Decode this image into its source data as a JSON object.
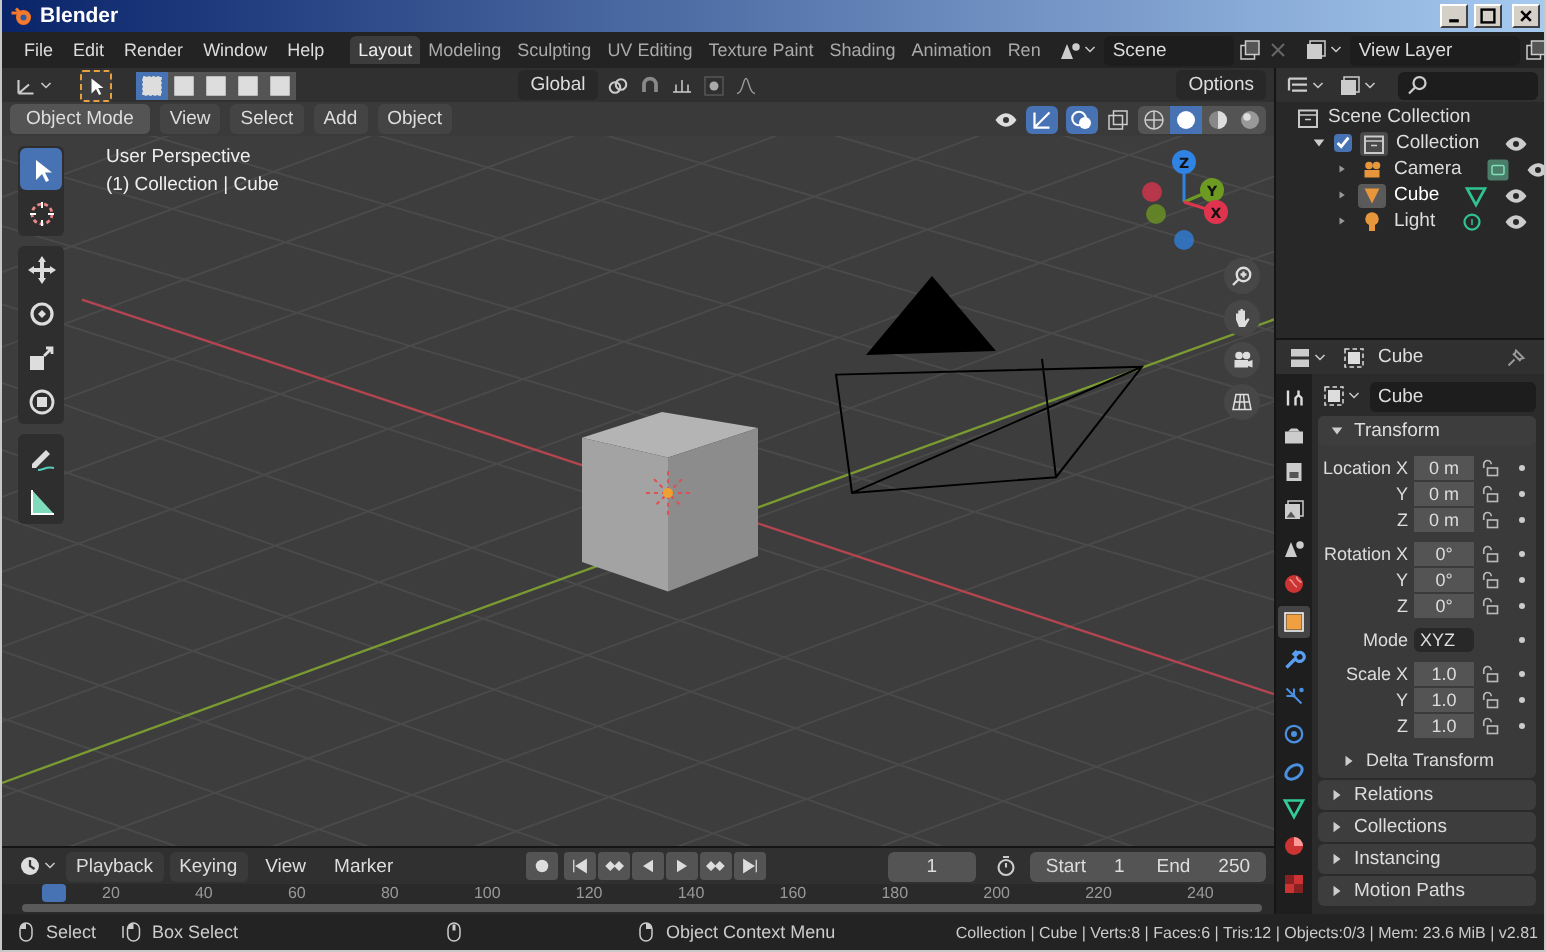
{
  "window": {
    "title": "Blender"
  },
  "menu": [
    "File",
    "Edit",
    "Render",
    "Window",
    "Help"
  ],
  "workspaces": [
    {
      "label": "Layout",
      "selected": true
    },
    {
      "label": "Modeling",
      "selected": false
    },
    {
      "label": "Sculpting",
      "selected": false
    },
    {
      "label": "UV Editing",
      "selected": false
    },
    {
      "label": "Texture Paint",
      "selected": false
    },
    {
      "label": "Shading",
      "selected": false
    },
    {
      "label": "Animation",
      "selected": false
    },
    {
      "label": "Ren",
      "selected": false
    }
  ],
  "scene": {
    "value": "Scene"
  },
  "view_layer": {
    "value": "View Layer"
  },
  "viewport": {
    "select_tool_on": true,
    "select_modes": [
      {
        "selected": true
      },
      {
        "selected": false
      },
      {
        "selected": false
      },
      {
        "selected": false
      },
      {
        "selected": false
      }
    ],
    "orientation": "Global",
    "options": "Options",
    "mode": "Object Mode",
    "menus": [
      "View",
      "Select",
      "Add",
      "Object"
    ],
    "gizmos_on": true,
    "overlays_on": true,
    "shading_modes": [
      {
        "kind": "wireframe",
        "selected": false
      },
      {
        "kind": "solid",
        "selected": true
      },
      {
        "kind": "material",
        "selected": false
      },
      {
        "kind": "rendered",
        "selected": false
      }
    ],
    "overlay_text": [
      "User Perspective",
      "(1) Collection | Cube"
    ],
    "tool_groups": [
      [
        {
          "kind": "select",
          "selected": true
        },
        {
          "kind": "cursor",
          "selected": false
        }
      ],
      [
        {
          "kind": "move",
          "selected": false
        },
        {
          "kind": "rotate",
          "selected": false
        },
        {
          "kind": "scale",
          "selected": false
        },
        {
          "kind": "transform",
          "selected": false
        }
      ],
      [
        {
          "kind": "annotate",
          "selected": false
        },
        {
          "kind": "measure",
          "selected": false
        }
      ]
    ],
    "gizmo_axes": [
      {
        "label": "Z",
        "color": "#2f83e3"
      },
      {
        "label": "Y",
        "color": "#6d9a20"
      },
      {
        "label": "X",
        "color": "#e0344e"
      }
    ]
  },
  "outliner": {
    "tree": [
      {
        "label": "Scene Collection",
        "kind": "scene",
        "children": [
          {
            "label": "Collection",
            "kind": "collection",
            "checked": true,
            "expanded": true,
            "children": [
              {
                "label": "Camera",
                "kind": "camera",
                "selected": false
              },
              {
                "label": "Cube",
                "kind": "mesh",
                "selected": true
              },
              {
                "label": "Light",
                "kind": "light",
                "selected": false
              }
            ]
          }
        ]
      }
    ]
  },
  "properties": {
    "object": "Cube",
    "name": "Cube",
    "tabs": [
      {
        "kind": "tool",
        "selected": false
      },
      {
        "kind": "render",
        "selected": false
      },
      {
        "kind": "output",
        "selected": false
      },
      {
        "kind": "view_layer",
        "selected": false
      },
      {
        "kind": "scene",
        "selected": false
      },
      {
        "kind": "world",
        "selected": false
      },
      {
        "kind": "object",
        "selected": true
      },
      {
        "kind": "modifiers",
        "selected": false
      },
      {
        "kind": "particles",
        "selected": false
      },
      {
        "kind": "physics",
        "selected": false
      },
      {
        "kind": "constraints",
        "selected": false
      },
      {
        "kind": "data",
        "selected": false
      },
      {
        "kind": "material",
        "selected": false
      },
      {
        "kind": "texture",
        "selected": false
      }
    ],
    "transform": {
      "title": "Transform",
      "expanded": true,
      "groups": [
        [
          {
            "kind": "number",
            "label": "Location X",
            "value": "0 m"
          },
          {
            "kind": "number",
            "label": "Y",
            "value": "0 m"
          },
          {
            "kind": "number",
            "label": "Z",
            "value": "0 m"
          }
        ],
        [
          {
            "kind": "number",
            "label": "Rotation X",
            "value": "0°"
          },
          {
            "kind": "number",
            "label": "Y",
            "value": "0°"
          },
          {
            "kind": "number",
            "label": "Z",
            "value": "0°"
          }
        ],
        [
          {
            "kind": "dropdown",
            "label": "Mode",
            "value": "XYZ"
          }
        ],
        [
          {
            "kind": "number",
            "label": "Scale X",
            "value": "1.0"
          },
          {
            "kind": "number",
            "label": "Y",
            "value": "1.0"
          },
          {
            "kind": "number",
            "label": "Z",
            "value": "1.0"
          }
        ]
      ]
    },
    "delta": {
      "title": "Delta Transform",
      "expanded": false
    },
    "panels": [
      {
        "title": "Relations",
        "expanded": false
      },
      {
        "title": "Collections",
        "expanded": false
      },
      {
        "title": "Instancing",
        "expanded": false
      },
      {
        "title": "Motion Paths",
        "expanded": false
      }
    ]
  },
  "timeline": {
    "menus": [
      {
        "label": "Playback",
        "kind": "dropdown"
      },
      {
        "label": "Keying",
        "kind": "dropdown"
      },
      {
        "label": "View",
        "kind": "menu"
      },
      {
        "label": "Marker",
        "kind": "menu"
      }
    ],
    "current_frame": "1",
    "start_label": "Start",
    "start": "1",
    "end_label": "End",
    "end": "250",
    "ruler": [
      "20",
      "40",
      "60",
      "80",
      "100",
      "120",
      "140",
      "160",
      "180",
      "200",
      "220",
      "240"
    ]
  },
  "status_bar": {
    "hints": [
      {
        "kind": "left",
        "label": "Select"
      },
      {
        "kind": "drag",
        "label": "Box Select"
      },
      {
        "kind": "middle"
      },
      {
        "kind": "right",
        "label": "Object Context Menu"
      }
    ],
    "stats": "Collection | Cube | Verts:8 | Faces:6 | Tris:12 | Objects:0/3 | Mem: 23.6 MiB | v2.81"
  }
}
